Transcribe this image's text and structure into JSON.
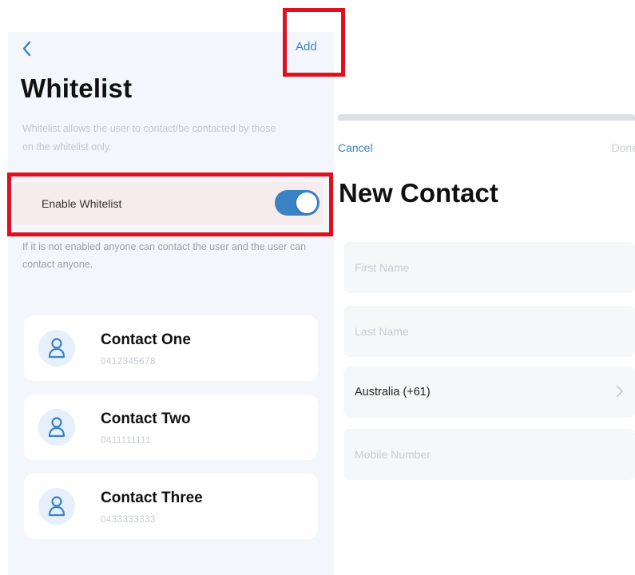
{
  "whitelist_screen": {
    "add_label": "Add",
    "title": "Whitelist",
    "description": "Whitelist allows the user to contact/be contacted by those on the whitelist only.",
    "toggle_label": "Enable Whitelist",
    "toggle_on": true,
    "hint": "If it is not enabled anyone can contact the user and the user can contact anyone.",
    "contacts": [
      {
        "name": "Contact One",
        "phone": "0412345678"
      },
      {
        "name": "Contact Two",
        "phone": "0411111111"
      },
      {
        "name": "Contact Three",
        "phone": "0433333333"
      }
    ]
  },
  "new_contact_screen": {
    "cancel_label": "Cancel",
    "done_label": "Done",
    "title": "New Contact",
    "first_name_placeholder": "First Name",
    "last_name_placeholder": "Last Name",
    "country_value": "Australia (+61)",
    "mobile_placeholder": "Mobile Number"
  },
  "colors": {
    "accent": "#3b82c4",
    "annotation": "#e01020",
    "highlight_row": "#f7eced"
  },
  "icons": {
    "back": "chevron-left-icon",
    "avatar": "person-icon",
    "country_select": "chevron-right-icon"
  }
}
